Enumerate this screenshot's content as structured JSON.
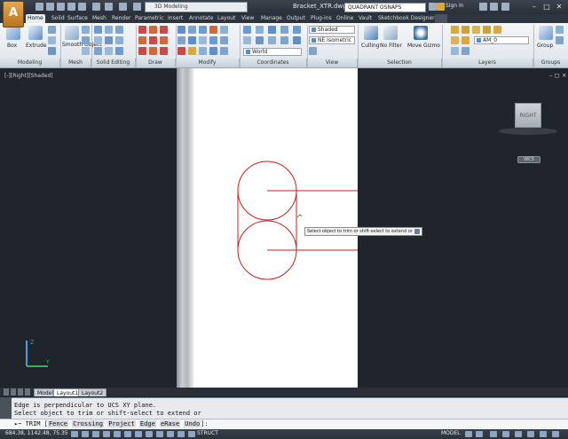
{
  "title_bar": {
    "app_button": "A",
    "workspace": "3D Modeling",
    "document_title": "Bracket_XTR.dwg",
    "search": "QUADRANT OSNAPS",
    "sign_in": "Sign In",
    "minimize": "–",
    "maximize": "□",
    "close": "✕"
  },
  "ribbon_tabs": [
    "Home",
    "Solid",
    "Surface",
    "Mesh",
    "Render",
    "Parametric",
    "Insert",
    "Annotate",
    "Layout",
    "View",
    "Manage",
    "Output",
    "Plug-ins",
    "Online",
    "Vault",
    "Sketchbook Designer"
  ],
  "active_tab": "Home",
  "ribbon": {
    "box_label": "Box",
    "extrude_label": "Extrude",
    "smooth_object_label": "Smooth Object",
    "visual_style": "Shaded",
    "view": "NE Isometric",
    "coord_system": "World",
    "culling_label": "Culling",
    "no_filter_label": "No Filter",
    "move_gizmo_label": "Move Gizmo",
    "layer": "AM_0",
    "group_label": "Group",
    "panels": [
      "Modeling",
      "Mesh",
      "Solid Editing",
      "Draw",
      "Modify",
      "Coordinates",
      "View",
      "Selection",
      "Layers",
      "Groups"
    ]
  },
  "viewport": {
    "label": "[-][Right][Shaded]",
    "controls": "– ◻ ×",
    "viewcube_face": "RIGHT",
    "wcs_label": "WCS",
    "tooltip": "Select object to trim or shift-select to extend or",
    "ucs_y": "Y",
    "ucs_z": "Z"
  },
  "layout_tabs": [
    "Model",
    "Layout1",
    "Layout2"
  ],
  "active_layout": "Layout1",
  "command_line": {
    "history": [
      "Edge is perpendicular to UCS XY plane.",
      "Select object to trim or shift-select to extend or"
    ],
    "prompt": "TRIM",
    "options": [
      "Fence",
      "Crossing",
      "Project",
      "Edge",
      "eRase",
      "Undo"
    ]
  },
  "status_bar": {
    "coordinates": "684.38, 1142.48, 75.35",
    "struct": "STRUCT",
    "model": "MODEL"
  },
  "colors": {
    "geometry": "#c81e1e",
    "viewport_bg": "#20242b",
    "paper": "#ffffff"
  }
}
